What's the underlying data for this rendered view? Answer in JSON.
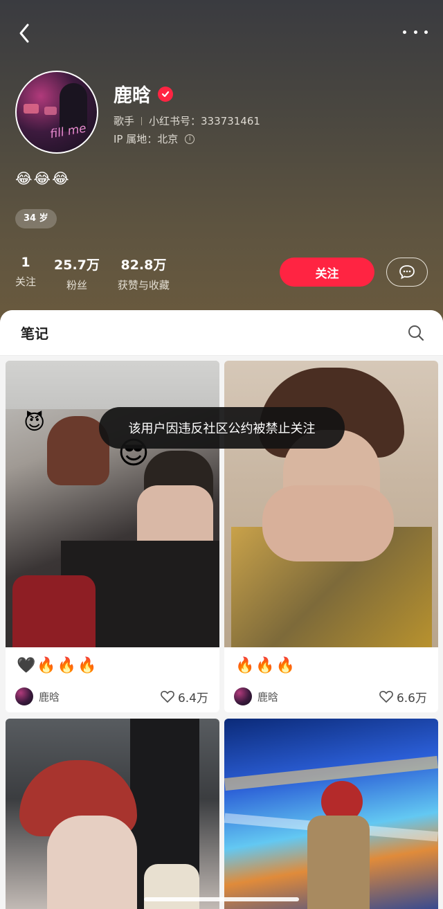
{
  "header": {
    "name": "鹿晗",
    "profession": "歌手",
    "id_label": "小红书号：333731461",
    "ip_label": "IP 属地：北京",
    "bio": "😂😂😂",
    "age_tag": "34 岁",
    "avatar_text": "fill me",
    "verified_color": "#ff2442"
  },
  "stats": [
    {
      "value": "1",
      "label": "关注"
    },
    {
      "value": "25.7万",
      "label": "粉丝"
    },
    {
      "value": "82.8万",
      "label": "获赞与收藏"
    }
  ],
  "actions": {
    "follow_label": "关注",
    "accent_color": "#ff2442"
  },
  "tabs": {
    "notes_label": "笔记"
  },
  "notes": [
    {
      "title": "🖤🔥🔥🔥",
      "author": "鹿晗",
      "likes": "6.4万"
    },
    {
      "title": "🔥🔥🔥",
      "author": "鹿晗",
      "likes": "6.6万"
    },
    {
      "title": "",
      "author": "",
      "likes": ""
    },
    {
      "title": "",
      "author": "",
      "likes": ""
    }
  ],
  "toast": "该用户因违反社区公约被禁止关注",
  "icons": [
    "back-icon",
    "more-icon",
    "verified-icon",
    "info-icon",
    "message-icon",
    "search-icon",
    "heart-icon"
  ]
}
